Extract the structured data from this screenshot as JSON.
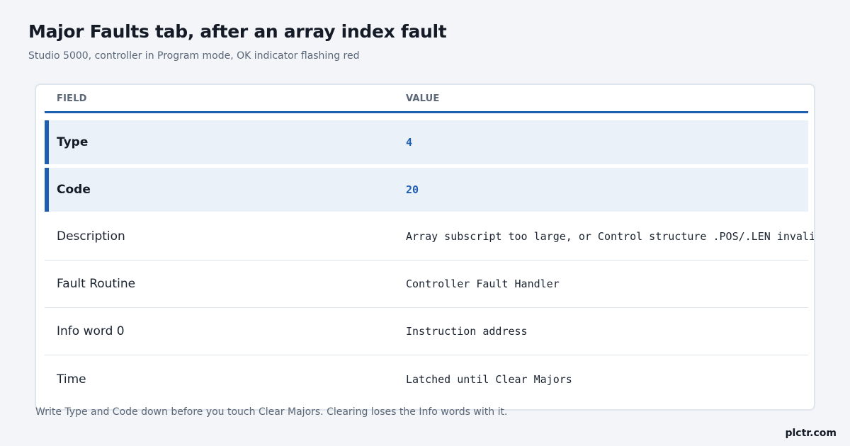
{
  "title": "Major Faults tab, after an array index fault",
  "subtitle": "Studio 5000, controller in Program mode, OK indicator flashing red",
  "table": {
    "headers": {
      "field": "FIELD",
      "value": "VALUE"
    },
    "rows": [
      {
        "field": "Type",
        "value": "4"
      },
      {
        "field": "Code",
        "value": "20"
      },
      {
        "field": "Description",
        "value": "Array subscript too large, or Control structure .POS/.LEN invalid"
      },
      {
        "field": "Fault Routine",
        "value": "Controller Fault Handler"
      },
      {
        "field": "Info word 0",
        "value": "Instruction address"
      },
      {
        "field": "Time",
        "value": "Latched until Clear Majors"
      }
    ]
  },
  "note": "Write Type and Code down before you touch Clear Majors. Clearing loses the Info words with it.",
  "brand": "plctr.com",
  "colors": {
    "accent": "#1f5fb2",
    "highlight_bg": "#ebf1f9"
  }
}
